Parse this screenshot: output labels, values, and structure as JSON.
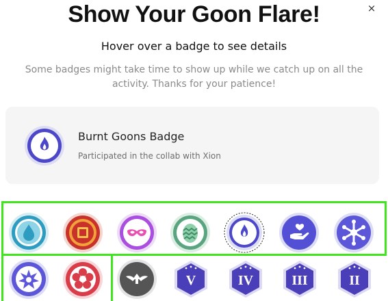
{
  "modal": {
    "title": "Show Your Goon Flare!",
    "subtitle": "Hover over a badge to see details",
    "note": "Some badges might take time to show up while we catch up on all the activity. Thanks for your patience!",
    "close_symbol": "×"
  },
  "selected_badge": {
    "name": "Burnt Goons Badge",
    "description": "Participated in the collab with Xion",
    "icon": "flame-badge-icon"
  },
  "badges": [
    {
      "icon": "water-drop-badge-icon",
      "color": "#2d9cc0"
    },
    {
      "icon": "red-square-badge-icon",
      "color": "#c8322a"
    },
    {
      "icon": "mask-badge-icon",
      "color": "#a94ee0"
    },
    {
      "icon": "egg-badge-icon",
      "color": "#5aa57f"
    },
    {
      "icon": "flame-badge-icon",
      "color": "#4b47c8",
      "selected": true
    },
    {
      "icon": "hand-heart-badge-icon",
      "color": "#5350d6"
    },
    {
      "icon": "snowflake-badge-icon",
      "color": "#5b57d8"
    },
    {
      "icon": "burst-star-badge-icon",
      "color": "#5b57d8"
    },
    {
      "icon": "red-flower-badge-icon",
      "color": "#d93d4a"
    },
    {
      "icon": "winged-arrow-badge-icon",
      "color": "#555555"
    },
    {
      "icon": "rank-badge-icon",
      "label": "V",
      "color": "#4a3fb8"
    },
    {
      "icon": "rank-badge-icon",
      "label": "IV",
      "color": "#4a3fb8"
    },
    {
      "icon": "rank-badge-icon",
      "label": "III",
      "color": "#4a3fb8"
    },
    {
      "icon": "rank-badge-icon",
      "label": "II",
      "color": "#4a3fb8"
    }
  ],
  "colors": {
    "highlight": "#3fe61e",
    "card_bg": "#f5f5f5",
    "muted_text": "#8a8a8a"
  }
}
